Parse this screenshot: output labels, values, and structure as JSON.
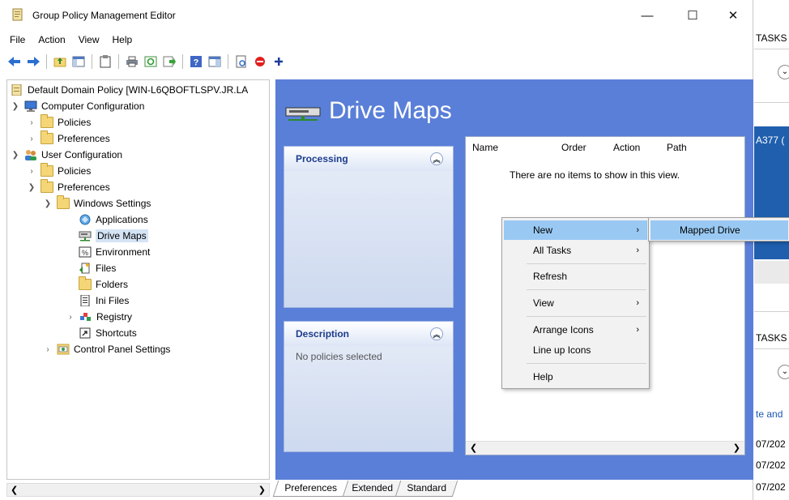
{
  "window": {
    "title": "Group Policy Management Editor",
    "controls": {
      "minimize": "—",
      "maximize": "☐",
      "close": "✕"
    }
  },
  "menu": [
    "File",
    "Action",
    "View",
    "Help"
  ],
  "tree": {
    "root": "Default Domain Policy [WIN-L6QBOFTLSPV.JR.LA",
    "computer_configuration": "Computer Configuration",
    "cc_policies": "Policies",
    "cc_preferences": "Preferences",
    "user_configuration": "User Configuration",
    "uc_policies": "Policies",
    "uc_preferences": "Preferences",
    "windows_settings": "Windows Settings",
    "applications": "Applications",
    "drive_maps": "Drive Maps",
    "environment": "Environment",
    "files": "Files",
    "folders": "Folders",
    "ini_files": "Ini Files",
    "registry": "Registry",
    "shortcuts": "Shortcuts",
    "control_panel_settings": "Control Panel Settings"
  },
  "extended": {
    "title": "Drive Maps",
    "processing_label": "Processing",
    "description_label": "Description",
    "description_text": "No policies selected"
  },
  "list": {
    "columns": [
      "Name",
      "Order",
      "Action",
      "Path"
    ],
    "empty_message": "There are no items to show in this view."
  },
  "tabs": [
    "Preferences",
    "Extended",
    "Standard"
  ],
  "context_menu": {
    "new": "New",
    "all_tasks": "All Tasks",
    "refresh": "Refresh",
    "view": "View",
    "arrange_icons": "Arrange Icons",
    "line_up_icons": "Line up Icons",
    "help": "Help"
  },
  "submenu": {
    "mapped_drive": "Mapped Drive"
  },
  "background_window": {
    "tasks_1": "TASKS",
    "server": "A377 (",
    "tasks_2": "TASKS",
    "link": "te and",
    "date_1": "07/202",
    "date_2": "07/202",
    "date_3": "07/202"
  }
}
